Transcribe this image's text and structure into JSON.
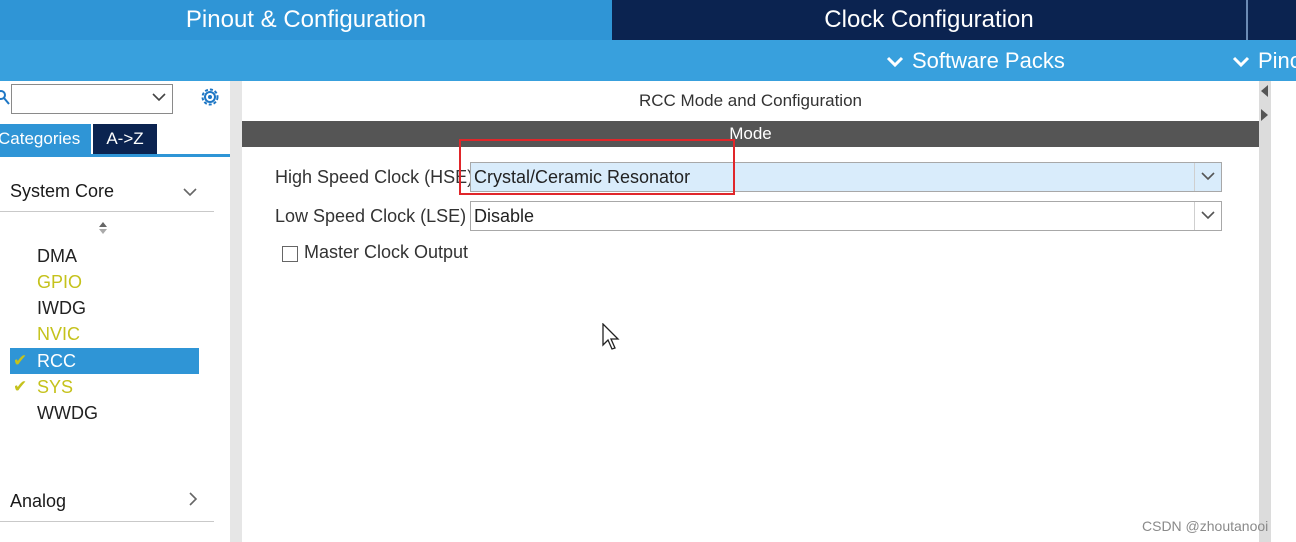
{
  "top_tabs": {
    "pinout": "Pinout & Configuration",
    "clock": "Clock Configuration"
  },
  "sub_menu": {
    "software_packs": "Software Packs",
    "pinout": "Pino"
  },
  "left_panel": {
    "tabs": {
      "categories": "Categories",
      "az": "A->Z"
    },
    "search": {
      "value": ""
    },
    "sections": {
      "system_core": "System Core",
      "analog": "Analog"
    },
    "peripherals": [
      {
        "name": "DMA",
        "check": "",
        "state": "normal"
      },
      {
        "name": "GPIO",
        "check": "",
        "state": "yellow"
      },
      {
        "name": "IWDG",
        "check": "",
        "state": "normal"
      },
      {
        "name": "NVIC",
        "check": "",
        "state": "yellow"
      },
      {
        "name": "RCC",
        "check": "✔",
        "state": "selected"
      },
      {
        "name": "SYS",
        "check": "✔",
        "state": "yellow"
      },
      {
        "name": "WWDG",
        "check": "",
        "state": "normal"
      }
    ]
  },
  "main_panel": {
    "title": "RCC Mode and Configuration",
    "mode_header": "Mode",
    "hse": {
      "label": "High Speed Clock (HSE)",
      "value": "Crystal/Ceramic Resonator"
    },
    "lse": {
      "label": "Low Speed Clock (LSE)",
      "value": "Disable"
    },
    "master_clock_output": {
      "label": "Master Clock Output",
      "checked": false
    }
  },
  "watermark": "CSDN @zhoutanooi",
  "colors": {
    "tab_active_blue": "#2f95d6",
    "tab_dark_navy": "#0b2350",
    "selected_item": "#2f95d6",
    "yellow_status": "#c5c21c",
    "highlight_red": "#e0262a",
    "mode_bar": "#555555"
  },
  "icons": [
    "search-icon",
    "gear-icon",
    "chevron-down-icon",
    "chevron-right-icon",
    "sort-icon",
    "check-icon",
    "mouse-cursor-icon"
  ]
}
